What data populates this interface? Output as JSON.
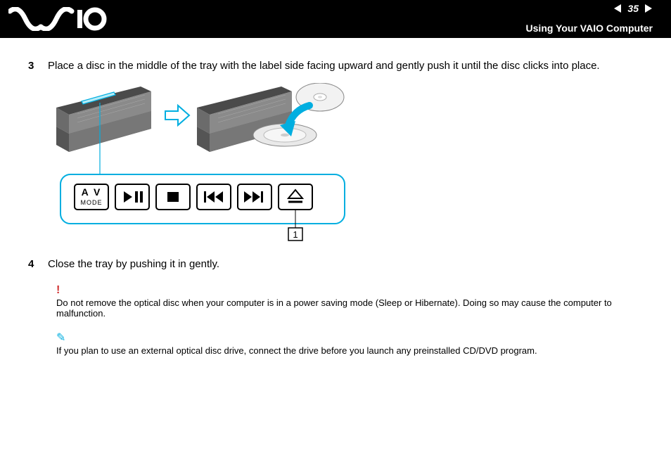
{
  "header": {
    "page_number": "35",
    "section_title": "Using Your VAIO Computer",
    "logo_alt": "VAIO"
  },
  "steps": {
    "s3": {
      "num": "3",
      "text": "Place a disc in the middle of the tray with the label side facing upward and gently push it until the disc clicks into place."
    },
    "s4": {
      "num": "4",
      "text": "Close the tray by pushing it in gently."
    }
  },
  "figure": {
    "av_mode_line1": "A V",
    "av_mode_line2": "MODE",
    "callout_label": "1"
  },
  "notes": {
    "warning": "Do not remove the optical disc when your computer is in a power saving mode (Sleep or Hibernate). Doing so may cause the computer to malfunction.",
    "tip": "If you plan to use an external optical disc drive, connect the drive before you launch any preinstalled CD/DVD program."
  }
}
